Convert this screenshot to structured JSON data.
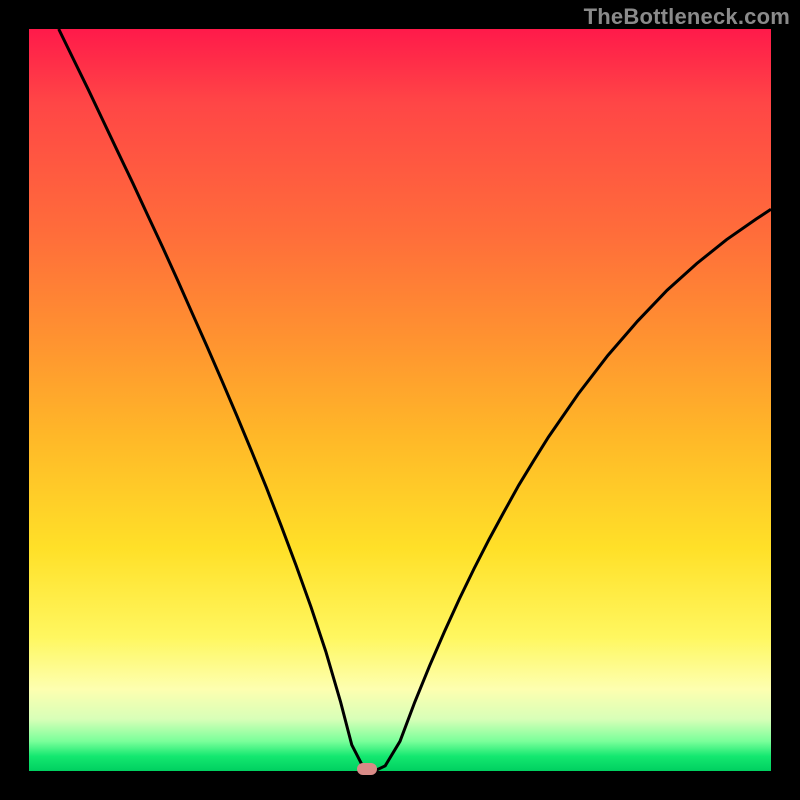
{
  "watermark": "TheBottleneck.com",
  "colors": {
    "frame": "#000000",
    "watermark_text": "#8a8a8a",
    "curve_stroke": "#000000",
    "marker_fill": "#d98b87"
  },
  "chart_data": {
    "type": "line",
    "title": "",
    "xlabel": "",
    "ylabel": "",
    "xlim": [
      0,
      100
    ],
    "ylim": [
      0,
      100
    ],
    "grid": false,
    "legend": false,
    "series": [
      {
        "name": "bottleneck-curve",
        "x": [
          4,
          6,
          8,
          10,
          12,
          14,
          16,
          18,
          20,
          22,
          24,
          26,
          28,
          30,
          32,
          34,
          36,
          38,
          40,
          42,
          43.5,
          45,
          46,
          47,
          48,
          50,
          52,
          54,
          56,
          58,
          60,
          62,
          64,
          66,
          68,
          70,
          74,
          78,
          82,
          86,
          90,
          94,
          98,
          100
        ],
        "values": [
          100,
          95.9,
          91.8,
          87.6,
          83.4,
          79.2,
          74.9,
          70.6,
          66.2,
          61.7,
          57.2,
          52.6,
          47.9,
          43.1,
          38.2,
          33.0,
          27.7,
          22.1,
          16.1,
          9.3,
          3.5,
          0.6,
          0.3,
          0.2,
          0.7,
          4.0,
          9.3,
          14.2,
          18.8,
          23.2,
          27.3,
          31.2,
          34.9,
          38.5,
          41.8,
          45.0,
          50.8,
          56.0,
          60.6,
          64.8,
          68.4,
          71.6,
          74.4,
          75.7
        ]
      }
    ],
    "marker": {
      "x": 45.5,
      "y": 0.25
    },
    "notes": "x and y are in 0-100 fractional units of the plot area (x left→right, y bottom→top). Curve values estimated from pixel readout; no axis ticks or labels are present in the image."
  }
}
